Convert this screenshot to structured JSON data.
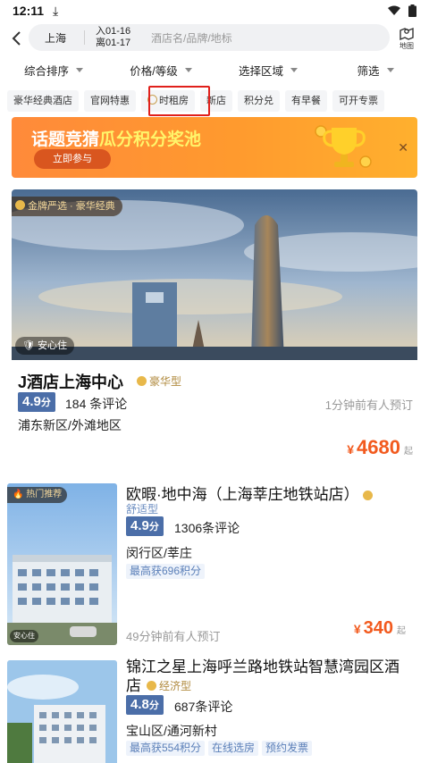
{
  "status": {
    "time": "12:11"
  },
  "search": {
    "city": "上海",
    "checkin": "入01-16",
    "checkout": "离01-17",
    "placeholder": "酒店名/品牌/地标",
    "map_label": "地图"
  },
  "filters": [
    "综合排序",
    "价格/等级",
    "选择区域",
    "筛选"
  ],
  "tags": [
    "豪华经典酒店",
    "官网特惠",
    "时租房",
    "新店",
    "积分兑",
    "有早餐",
    "可开专票"
  ],
  "banner": {
    "title_white": "话题竞猜",
    "title_yellow": "瓜分积分奖池",
    "button": "立即参与"
  },
  "hotels": [
    {
      "badge": "金牌严选 · 豪华经典",
      "safe": "安心住",
      "name": "J酒店上海中心",
      "type": "豪华型",
      "score": "4.9",
      "score_unit": "分",
      "reviews": "184 条评论",
      "recent": "1分钟前有人预订",
      "area": "浦东新区/外滩地区",
      "currency": "¥",
      "price": "4680",
      "price_suffix": "起"
    },
    {
      "badge": "热门推荐",
      "safe": "安心住",
      "name": "欧暇·地中海（上海莘庄地铁站店）",
      "type": "舒适型",
      "score": "4.9",
      "score_unit": "分",
      "reviews": "1306条评论",
      "area": "闵行区/莘庄",
      "points": "最高获696积分",
      "recent": "49分钟前有人预订",
      "currency": "¥",
      "price": "340",
      "price_suffix": "起"
    },
    {
      "name": "锦江之星上海呼兰路地铁站智慧湾园区酒店",
      "type": "经济型",
      "score": "4.8",
      "score_unit": "分",
      "reviews": "687条评论",
      "area": "宝山区/通河新村",
      "pills": [
        "最高获554积分",
        "在线选房",
        "预约发票"
      ]
    }
  ]
}
